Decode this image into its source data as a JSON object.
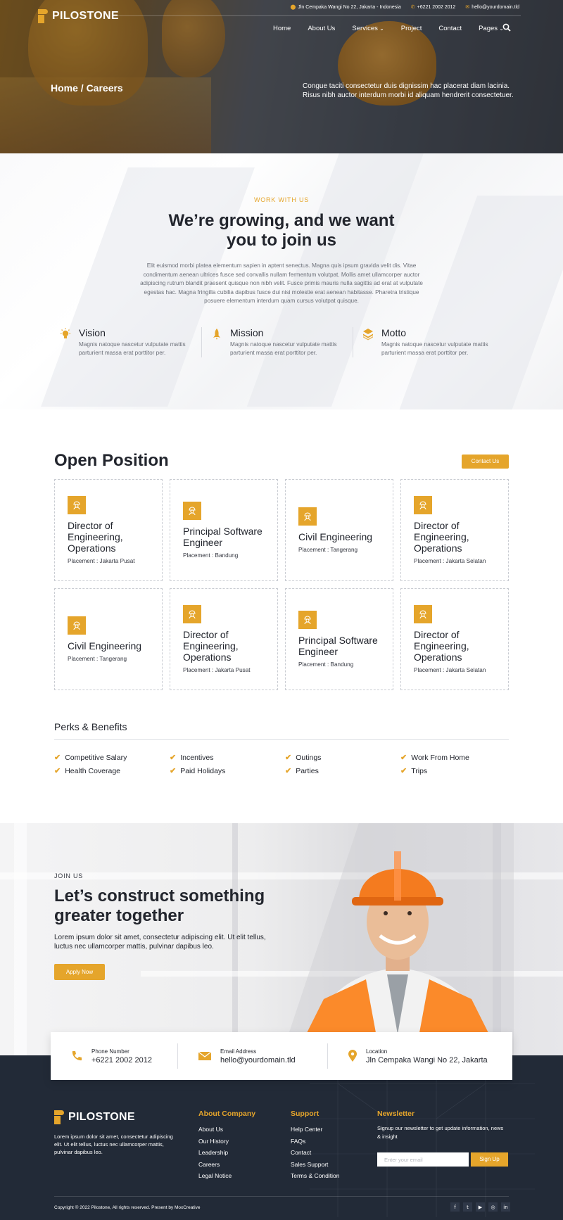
{
  "brand": {
    "name": "PILOSTONE",
    "accent": "#e5a52b",
    "dark": "#222a37"
  },
  "topbar": {
    "address": "Jln Cempaka Wangi No 22, Jakarta - Indonesia",
    "phone": "+6221 2002 2012",
    "email": "hello@yourdomain.tld"
  },
  "nav": {
    "items": [
      "Home",
      "About Us",
      "Services",
      "Project",
      "Contact",
      "Pages"
    ],
    "search_icon": "search-icon"
  },
  "hero": {
    "breadcrumb": "Home / Careers",
    "text": "Congue taciti consectetur duis dignissim hac placerat diam lacinia. Risus nibh auctor interdum morbi id aliquam hendrerit consectetuer."
  },
  "work": {
    "eyebrow": "WORK WITH US",
    "title_line1": "We’re growing, and we want",
    "title_line2": "you to join us",
    "lead": "Elit euismod morbi platea elementum sapien in aptent senectus. Magna quis ipsum gravida velit dis. Vitae condimentum aenean ultrices fusce sed convallis nullam fermentum volutpat. Mollis amet ullamcorper auctor adipiscing rutrum blandit praesent quisque non nibh velit. Fusce primis mauris nulla sagittis ad erat at vulputate egestas hac. Magna fringilla cubilia dapibus fusce dui nisi molestie erat aenean habitasse. Pharetra tristique posuere elementum interdum quam cursus volutpat quisque.",
    "pillars": [
      {
        "title": "Vision",
        "text": "Magnis natoque nascetur vulputate mattis parturient massa erat porttitor per.",
        "icon": "lightbulb-icon"
      },
      {
        "title": "Mission",
        "text": "Magnis natoque nascetur vulputate mattis parturient massa erat porttitor per.",
        "icon": "rocket-icon"
      },
      {
        "title": "Motto",
        "text": "Magnis natoque nascetur vulputate mattis parturient massa erat porttitor per.",
        "icon": "layers-icon"
      }
    ]
  },
  "positions": {
    "title": "Open Position",
    "contact_label": "Contact Us",
    "cards": [
      {
        "title": "Director of Engineering, Operations",
        "placement": "Placement : Jakarta Pusat"
      },
      {
        "title": "Principal Software Engineer",
        "placement": "Placement : Bandung"
      },
      {
        "title": "Civil Engineering",
        "placement": "Placement : Tangerang"
      },
      {
        "title": "Director of Engineering, Operations",
        "placement": "Placement : Jakarta Selatan"
      },
      {
        "title": "Civil Engineering",
        "placement": "Placement : Tangerang"
      },
      {
        "title": "Director of Engineering, Operations",
        "placement": "Placement : Jakarta Pusat"
      },
      {
        "title": "Principal Software Engineer",
        "placement": "Placement : Bandung"
      },
      {
        "title": "Director of Engineering, Operations",
        "placement": "Placement : Jakarta Selatan"
      }
    ]
  },
  "perks": {
    "title": "Perks & Benefits",
    "items": [
      "Competitive Salary",
      "Incentives",
      "Outings",
      "Work From Home",
      "Health Coverage",
      "Paid Holidays",
      "Parties",
      "Trips"
    ]
  },
  "join": {
    "eyebrow": "JOIN US",
    "title": "Let’s construct something greater together",
    "text": "Lorem ipsum dolor sit amet, consectetur adipiscing elit. Ut elit tellus, luctus nec ullamcorper mattis, pulvinar dapibus leo.",
    "apply_label": "Apply Now"
  },
  "contact_strip": [
    {
      "label": "Phone Number",
      "value": "+6221 2002 2012",
      "icon": "phone-icon"
    },
    {
      "label": "Email Address",
      "value": "hello@yourdomain.tld",
      "icon": "envelope-icon"
    },
    {
      "label": "Location",
      "value": "Jln Cempaka Wangi No 22, Jakarta",
      "icon": "map-pin-icon"
    }
  ],
  "footer": {
    "about": "Lorem ipsum dolor sit amet, consectetur adipiscing elit. Ut elit tellus, luctus nec ullamcorper mattis, pulvinar dapibus leo.",
    "company": {
      "title": "About Company",
      "links": [
        "About Us",
        "Our History",
        "Leadership",
        "Careers",
        "Legal Notice"
      ]
    },
    "support": {
      "title": "Support",
      "links": [
        "Help Center",
        "FAQs",
        "Contact",
        "Sales Support",
        "Terms & Condition"
      ]
    },
    "newsletter": {
      "title": "Newsletter",
      "text": "Signup our newsletter to get update information, news & insight",
      "placeholder": "Enter your email",
      "button": "Sign Up"
    },
    "copyright": "Copyright © 2022 Pilostone, All rights reserved. Present by MoxCreative",
    "social": [
      "f",
      "t",
      "▶",
      "◎",
      "in"
    ]
  }
}
